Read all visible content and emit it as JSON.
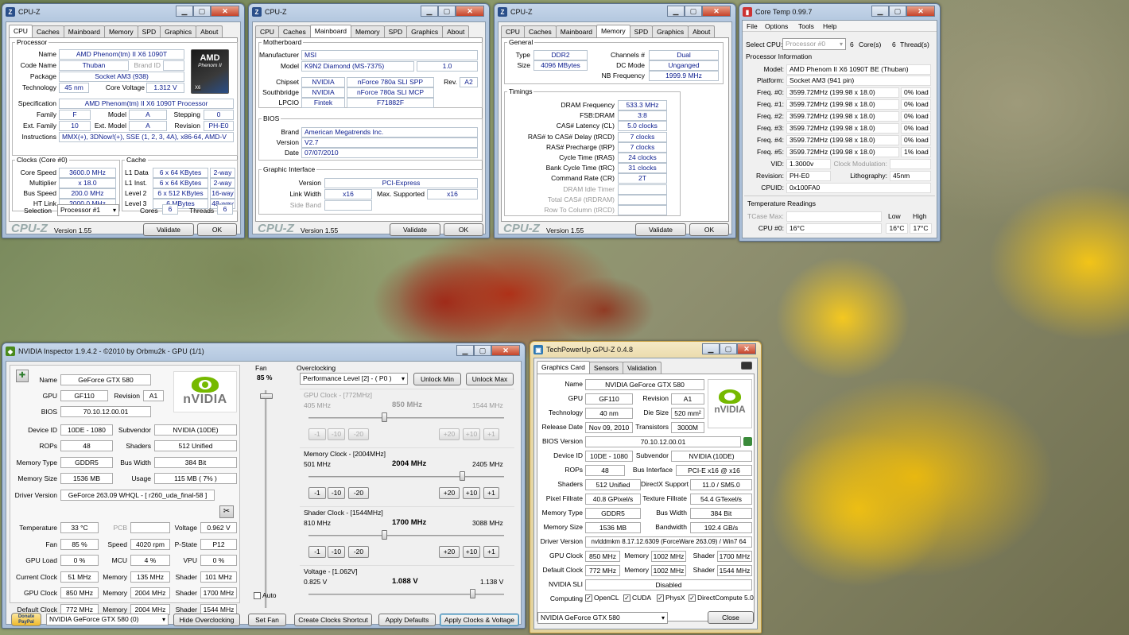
{
  "cpuz1": {
    "title": "CPU-Z",
    "tabs": [
      "CPU",
      "Caches",
      "Mainboard",
      "Memory",
      "SPD",
      "Graphics",
      "About"
    ],
    "active": 0,
    "processor_legend": "Processor",
    "name_l": "Name",
    "name": "AMD Phenom(tm) II X6 1090T",
    "code_l": "Code Name",
    "code": "Thuban",
    "brand_l": "Brand ID",
    "pkg_l": "Package",
    "pkg": "Socket AM3 (938)",
    "tech_l": "Technology",
    "tech": "45 nm",
    "cv_l": "Core Voltage",
    "cv": "1.312 V",
    "spec_l": "Specification",
    "spec": "AMD Phenom(tm) II X6 1090T Processor",
    "fam_l": "Family",
    "fam": "F",
    "model_l": "Model",
    "model": "A",
    "step_l": "Stepping",
    "step": "0",
    "efam_l": "Ext. Family",
    "efam": "10",
    "emodel_l": "Ext. Model",
    "emodel": "A",
    "rev_l": "Revision",
    "rev": "PH-E0",
    "inst_l": "Instructions",
    "inst": "MMX(+), 3DNow!(+), SSE (1, 2, 3, 4A), x86-64, AMD-V",
    "clocks_legend": "Clocks (Core #0)",
    "cs_l": "Core Speed",
    "cs": "3600.0 MHz",
    "mul_l": "Multiplier",
    "mul": "x 18.0",
    "bus_l": "Bus Speed",
    "bus": "200.0 MHz",
    "ht_l": "HT Link",
    "ht": "2000.0 MHz",
    "cache_legend": "Cache",
    "l1d_l": "L1 Data",
    "l1d": "6 x 64 KBytes",
    "l1d_w": "2-way",
    "l1i_l": "L1 Inst.",
    "l1i": "6 x 64 KBytes",
    "l1i_w": "2-way",
    "l2_l": "Level 2",
    "l2": "6 x 512 KBytes",
    "l2_w": "16-way",
    "l3_l": "Level 3",
    "l3": "6 MBytes",
    "l3_w": "48-way",
    "sel_l": "Selection",
    "sel": "Processor #1",
    "cores_l": "Cores",
    "cores": "6",
    "threads_l": "Threads",
    "threads": "6",
    "logo_l1": "AMD",
    "logo_l2": "Phenom II",
    "logo_l3": "X6",
    "brand": "CPU-Z",
    "version": "Version 1.55",
    "validate": "Validate",
    "ok": "OK"
  },
  "cpuz2": {
    "title": "CPU-Z",
    "active": 2,
    "mb_legend": "Motherboard",
    "mfr_l": "Manufacturer",
    "mfr": "MSI",
    "model_l": "Model",
    "model": "K9N2 Diamond (MS-7375)",
    "model_v": "1.0",
    "chip_l": "Chipset",
    "chip_v": "NVIDIA",
    "chip": "nForce 780a SLI SPP",
    "rev_l": "Rev.",
    "rev": "A2",
    "sb_l": "Southbridge",
    "sb_v": "NVIDIA",
    "sb": "nForce 780a SLI MCP",
    "lpcio_l": "LPCIO",
    "lpcio_v": "Fintek",
    "lpcio": "F71882F",
    "bios_legend": "BIOS",
    "brand_l": "Brand",
    "brand_v": "American Megatrends Inc.",
    "ver_l": "Version",
    "ver_v": "V2.7",
    "date_l": "Date",
    "date_v": "07/07/2010",
    "gi_legend": "Graphic Interface",
    "giver_l": "Version",
    "giver": "PCI-Express",
    "lw_l": "Link Width",
    "lw": "x16",
    "ms_l": "Max. Supported",
    "ms": "x16",
    "sband_l": "Side Band",
    "brand": "CPU-Z",
    "version": "Version 1.55",
    "validate": "Validate",
    "ok": "OK"
  },
  "cpuz3": {
    "title": "CPU-Z",
    "active": 3,
    "gen_legend": "General",
    "type_l": "Type",
    "type": "DDR2",
    "ch_l": "Channels #",
    "ch": "Dual",
    "size_l": "Size",
    "size": "4096 MBytes",
    "dc_l": "DC Mode",
    "dc": "Unganged",
    "nb_l": "NB Frequency",
    "nb": "1999.9 MHz",
    "tim_legend": "Timings",
    "timings": [
      {
        "l": "DRAM Frequency",
        "v": "533.3 MHz"
      },
      {
        "l": "FSB:DRAM",
        "v": "3:8"
      },
      {
        "l": "CAS# Latency (CL)",
        "v": "5.0 clocks"
      },
      {
        "l": "RAS# to CAS# Delay (tRCD)",
        "v": "7 clocks"
      },
      {
        "l": "RAS# Precharge (tRP)",
        "v": "7 clocks"
      },
      {
        "l": "Cycle Time (tRAS)",
        "v": "24 clocks"
      },
      {
        "l": "Bank Cycle Time (tRC)",
        "v": "31 clocks"
      },
      {
        "l": "Command Rate (CR)",
        "v": "2T"
      },
      {
        "l": "DRAM Idle Timer",
        "v": ""
      },
      {
        "l": "Total CAS# (tRDRAM)",
        "v": ""
      },
      {
        "l": "Row To Column (tRCD)",
        "v": ""
      }
    ],
    "brand": "CPU-Z",
    "version": "Version 1.55",
    "validate": "Validate",
    "ok": "OK"
  },
  "coretemp": {
    "title": "Core Temp 0.99.7",
    "menu": [
      "File",
      "Options",
      "Tools",
      "Help"
    ],
    "selcpu_l": "Select CPU:",
    "selcpu": "Processor #0",
    "cores_n": "6",
    "cores_l": "Core(s)",
    "thr_n": "6",
    "thr_l": "Thread(s)",
    "pinfo_l": "Processor Information",
    "model_l": "Model:",
    "model": "AMD Phenom II X6 1090T BE (Thuban)",
    "plat_l": "Platform:",
    "plat": "Socket AM3 (941 pin)",
    "freqs": [
      {
        "l": "Freq. #0:",
        "v": "3599.72MHz (199.98 x 18.0)",
        "load": "0% load"
      },
      {
        "l": "Freq. #1:",
        "v": "3599.72MHz (199.98 x 18.0)",
        "load": "0% load"
      },
      {
        "l": "Freq. #2:",
        "v": "3599.72MHz (199.98 x 18.0)",
        "load": "0% load"
      },
      {
        "l": "Freq. #3:",
        "v": "3599.72MHz (199.98 x 18.0)",
        "load": "0% load"
      },
      {
        "l": "Freq. #4:",
        "v": "3599.72MHz (199.98 x 18.0)",
        "load": "0% load"
      },
      {
        "l": "Freq. #5:",
        "v": "3599.72MHz (199.98 x 18.0)",
        "load": "1% load"
      }
    ],
    "vid_l": "VID:",
    "vid": "1.3000v",
    "cm_l": "Clock Modulation:",
    "rev_l": "Revision:",
    "rev": "PH-E0",
    "lith_l": "Lithography:",
    "lith": "45nm",
    "cpuid_l": "CPUID:",
    "cpuid": "0x100FA0",
    "tr_l": "Temperature Readings",
    "tcase_l": "TCase Max:",
    "low_l": "Low",
    "high_l": "High",
    "cpu0_l": "CPU #0:",
    "cpu0": "16°C",
    "cpu0_low": "16°C",
    "cpu0_high": "17°C"
  },
  "inspector": {
    "title": "NVIDIA Inspector 1.9.4.2 - ©2010 by Orbmu2k - GPU (1/1)",
    "rows": [
      {
        "a_l": "Name",
        "a": "GeForce GTX 580"
      },
      {
        "a_l": "GPU",
        "a": "GF110",
        "b_l": "Revision",
        "b": "A1"
      },
      {
        "a_l": "BIOS",
        "a": "70.10.12.00.01"
      },
      {
        "a_l": "Device ID",
        "a": "10DE - 1080",
        "b_l": "Subvendor",
        "b": "NVIDIA (10DE)"
      },
      {
        "a_l": "ROPs",
        "a": "48",
        "b_l": "Shaders",
        "b": "512 Unified"
      },
      {
        "a_l": "Memory Type",
        "a": "GDDR5",
        "b_l": "Bus Width",
        "b": "384 Bit"
      },
      {
        "a_l": "Memory Size",
        "a": "1536 MB",
        "b_l": "Usage",
        "b": "115 MB ( 7% )"
      },
      {
        "a_l": "Driver Version",
        "a": "GeForce 263.09 WHQL - [ r260_uda_final-58 ]"
      }
    ],
    "rows2": [
      {
        "a_l": "Temperature",
        "a": "33 °C",
        "b_l": "PCB",
        "b": "",
        "c_l": "Voltage",
        "c": "0.962 V"
      },
      {
        "a_l": "Fan",
        "a": "85 %",
        "b_l": "Speed",
        "b": "4020 rpm",
        "c_l": "P-State",
        "c": "P12"
      },
      {
        "a_l": "GPU Load",
        "a": "0 %",
        "b_l": "MCU",
        "b": "4 %",
        "c_l": "VPU",
        "c": "0 %"
      },
      {
        "a_l": "Current Clock",
        "a": "51 MHz",
        "b_l": "Memory",
        "b": "135 MHz",
        "c_l": "Shader",
        "c": "101 MHz"
      },
      {
        "a_l": "GPU Clock",
        "a": "850 MHz",
        "b_l": "Memory",
        "b": "2004 MHz",
        "c_l": "Shader",
        "c": "1700 MHz"
      },
      {
        "a_l": "Default Clock",
        "a": "772 MHz",
        "b_l": "Memory",
        "b": "2004 MHz",
        "c_l": "Shader",
        "c": "1544 MHz"
      }
    ],
    "nvidia_logo": "nVIDIA",
    "fan_l": "Fan",
    "fan": "85 %",
    "fan_level": 0.85,
    "auto_l": "Auto",
    "oc_l": "Overclocking",
    "perf": "Performance Level [2] - ( P0 )",
    "unlock_min": "Unlock Min",
    "unlock_max": "Unlock Max",
    "gpuclk": {
      "title": "GPU Clock - [772MHz]",
      "min": "405 MHz",
      "cur": "850 MHz",
      "max": "1544 MHz",
      "frac": 0.39
    },
    "memclk": {
      "title": "Memory Clock - [2004MHz]",
      "min": "501 MHz",
      "cur": "2004 MHz",
      "max": "2405 MHz",
      "frac": 0.79
    },
    "shclk": {
      "title": "Shader Clock - [1544MHz]",
      "min": "810 MHz",
      "cur": "1700 MHz",
      "max": "3088 MHz",
      "frac": 0.39
    },
    "volt": {
      "title": "Voltage - [1.062V]",
      "min": "0.825 V",
      "cur": "1.088 V",
      "max": "1.138 V",
      "frac": 0.84
    },
    "m1": "-1",
    "m10": "-10",
    "m20": "-20",
    "p20": "+20",
    "p10": "+10",
    "p1": "+1",
    "donate": "Donate PayPal",
    "gpu_sel": "NVIDIA GeForce GTX 580 (0)",
    "hide_oc": "Hide Overclocking",
    "set_fan": "Set Fan",
    "shortcut": "Create Clocks Shortcut",
    "apply_def": "Apply Defaults",
    "apply": "Apply Clocks & Voltage"
  },
  "gpuz": {
    "title": "TechPowerUp GPU-Z 0.4.8",
    "tabs": [
      "Graphics Card",
      "Sensors",
      "Validation"
    ],
    "name_l": "Name",
    "name": "NVIDIA GeForce GTX 580",
    "gpu_l": "GPU",
    "gpu": "GF110",
    "rev_l": "Revision",
    "rev": "A1",
    "tech_l": "Technology",
    "tech": "40 nm",
    "die_l": "Die Size",
    "die": "520 mm²",
    "rel_l": "Release Date",
    "rel": "Nov 09, 2010",
    "tr_l": "Transistors",
    "tr": "3000M",
    "bios_l": "BIOS Version",
    "bios": "70.10.12.00.01",
    "dev_l": "Device ID",
    "dev": "10DE - 1080",
    "sub_l": "Subvendor",
    "sub": "NVIDIA (10DE)",
    "rops_l": "ROPs",
    "rops": "48",
    "bi_l": "Bus Interface",
    "bi": "PCI-E x16 @ x16",
    "sh_l": "Shaders",
    "sh": "512 Unified",
    "dx_l": "DirectX Support",
    "dx": "11.0 / SM5.0",
    "pf_l": "Pixel Fillrate",
    "pf": "40.8 GPixel/s",
    "tf_l": "Texture Fillrate",
    "tf": "54.4 GTexel/s",
    "mt_l": "Memory Type",
    "mt": "GDDR5",
    "bw_l": "Bus Width",
    "bw": "384 Bit",
    "ms_l": "Memory Size",
    "ms": "1536 MB",
    "band_l": "Bandwidth",
    "band": "192.4 GB/s",
    "dv_l": "Driver Version",
    "dv": "nvlddmkm 8.17.12.6309 (ForceWare 263.09) / Win7 64",
    "gc_l": "GPU Clock",
    "gc": "850 MHz",
    "mem_l": "Memory",
    "gcm": "1002 MHz",
    "shd_l": "Shader",
    "gcs": "1700 MHz",
    "dc_l": "Default Clock",
    "dc": "772 MHz",
    "dcm": "1002 MHz",
    "dcs": "1544 MHz",
    "sli_l": "NVIDIA SLI",
    "sli": "Disabled",
    "comp_l": "Computing",
    "opencl": "OpenCL",
    "cuda": "CUDA",
    "physx": "PhysX",
    "dcomp": "DirectCompute 5.0",
    "card_sel": "NVIDIA GeForce GTX 580",
    "close": "Close",
    "nvidia_logo": "nVIDIA"
  }
}
